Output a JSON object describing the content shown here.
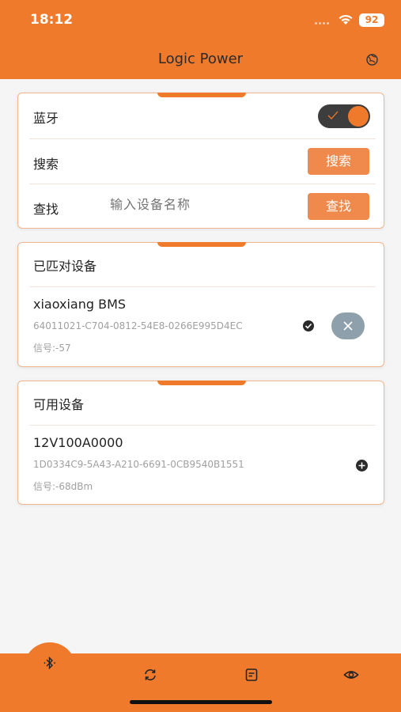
{
  "status_bar": {
    "time": "18:12",
    "battery": "92"
  },
  "header": {
    "title": "Logic Power"
  },
  "controls_card": {
    "bluetooth_label": "蓝牙",
    "bluetooth_on": true,
    "search_label": "搜索",
    "search_button": "搜索",
    "find_label": "查找",
    "find_placeholder": "输入设备名称",
    "find_button": "查找"
  },
  "paired_card": {
    "title": "已匹对设备",
    "devices": [
      {
        "name": "xiaoxiang BMS",
        "id": "64011021-C704-0812-54E8-0266E995D4EC",
        "signal": "信号:-57"
      }
    ]
  },
  "available_card": {
    "title": "可用设备",
    "devices": [
      {
        "name": "12V100A0000",
        "id": "1D0334C9-5A43-A210-6691-0CB9540B1551",
        "signal": "信号:-68dBm"
      }
    ]
  },
  "tabs": [
    {
      "icon": "bluetooth-icon",
      "active": true
    },
    {
      "icon": "refresh-icon"
    },
    {
      "icon": "document-icon"
    },
    {
      "icon": "eye-icon"
    }
  ],
  "colors": {
    "accent": "#f07a2c",
    "button": "#f08a4c",
    "toggle_track": "#3d3d3d",
    "remove": "#8ea0ab"
  }
}
